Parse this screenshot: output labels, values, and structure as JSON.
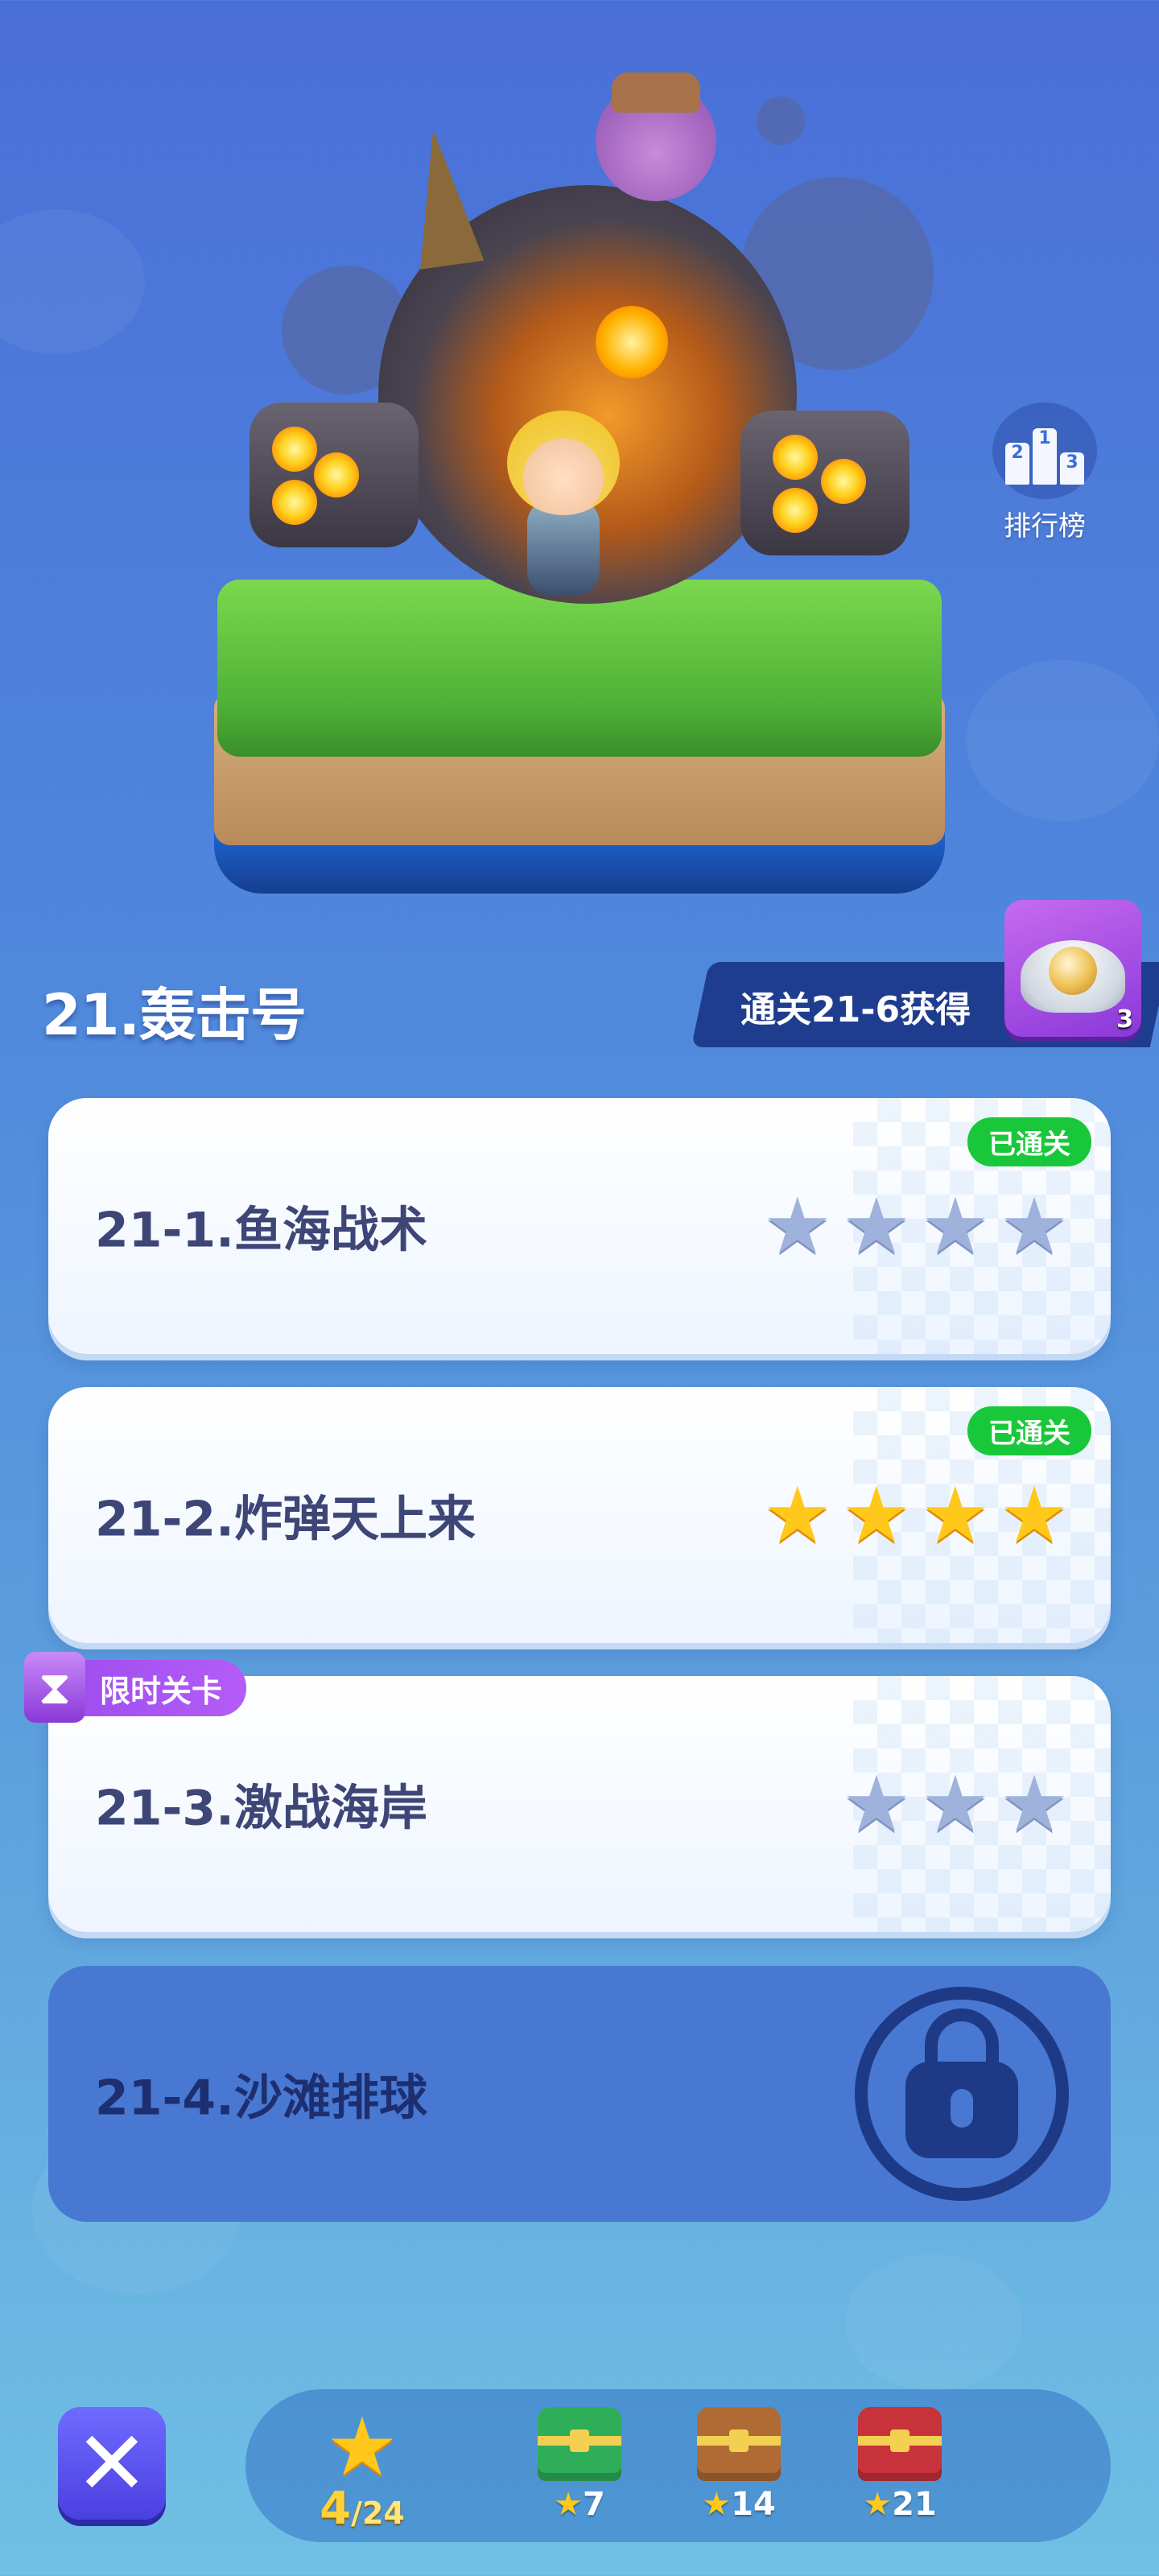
{
  "leaderboard": {
    "label": "排行榜",
    "ranks": [
      "2",
      "1",
      "3"
    ]
  },
  "chapter": {
    "title": "21.轰击号"
  },
  "reward": {
    "text": "通关21-6获得",
    "count": "3"
  },
  "levels": [
    {
      "name": "21-1.鱼海战术",
      "badge": "已通关",
      "stars_filled": 0,
      "stars_total": 4
    },
    {
      "name": "21-2.炸弹天上来",
      "badge": "已通关",
      "stars_filled": 4,
      "stars_total": 4
    },
    {
      "name": "21-3.激战海岸",
      "tag": "限时关卡",
      "stars_filled": 0,
      "stars_total": 3
    },
    {
      "name": "21-4.沙滩排球",
      "locked": true
    }
  ],
  "bottom": {
    "stars_collected": "4",
    "stars_total": "/24",
    "chests": [
      {
        "label": "7",
        "color": "#2fae5a"
      },
      {
        "label": "14",
        "color": "#b06a34"
      },
      {
        "label": "21",
        "color": "#c8323a"
      }
    ]
  },
  "icons": {
    "close": "close-icon",
    "star": "star-icon",
    "lock": "lock-icon",
    "hourglass": "hourglass-icon"
  }
}
